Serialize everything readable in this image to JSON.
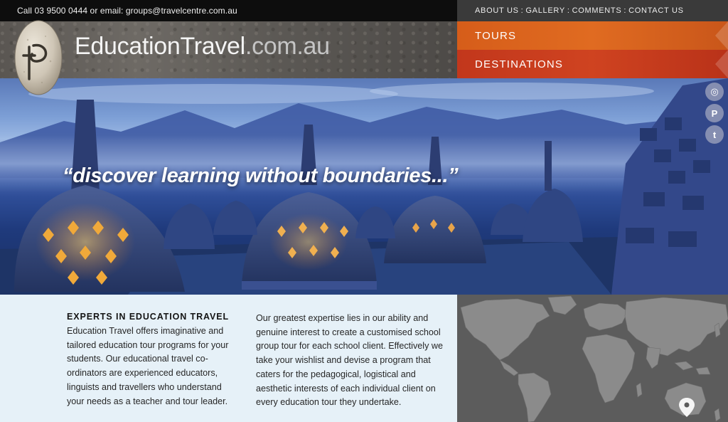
{
  "topbar": {
    "contact": "Call 03 9500 0444 or email: groups@travelcentre.com.au"
  },
  "topnav": {
    "items": [
      "ABOUT US",
      "GALLERY",
      "COMMENTS",
      "CONTACT US"
    ],
    "separator": ":"
  },
  "header": {
    "brand_main": "EducationTravel",
    "brand_tld": ".com.au"
  },
  "menu": {
    "tours": "TOURS",
    "destinations": "DESTINATIONS"
  },
  "hero": {
    "tagline": "“discover learning without boundaries...”"
  },
  "social": {
    "icons": [
      "instagram-icon",
      "pinterest-icon",
      "twitter-icon"
    ],
    "glyphs": [
      "◎",
      "P",
      "t"
    ]
  },
  "content": {
    "heading": "EXPERTS IN EDUCATION TRAVEL",
    "para1": "Education Travel offers imaginative and tailored education tour programs for your students. Our educational travel co-ordinators are experienced educators, linguists and travellers who understand your needs as a teacher and tour leader.",
    "para2": "Our greatest expertise lies in our ability and genuine interest to create a customised school group tour for each school client. Effectively we take your wishlist and devise a program that caters for the pedagogical, logistical and aesthetic interests of each individual client on every education tour they undertake."
  },
  "colors": {
    "tours_bg": "#e06b21",
    "destinations_bg": "#cf4320",
    "topbar_bg": "#0d0d0d",
    "map_bg": "#5c5c5c",
    "map_land": "#8a8a8a"
  }
}
